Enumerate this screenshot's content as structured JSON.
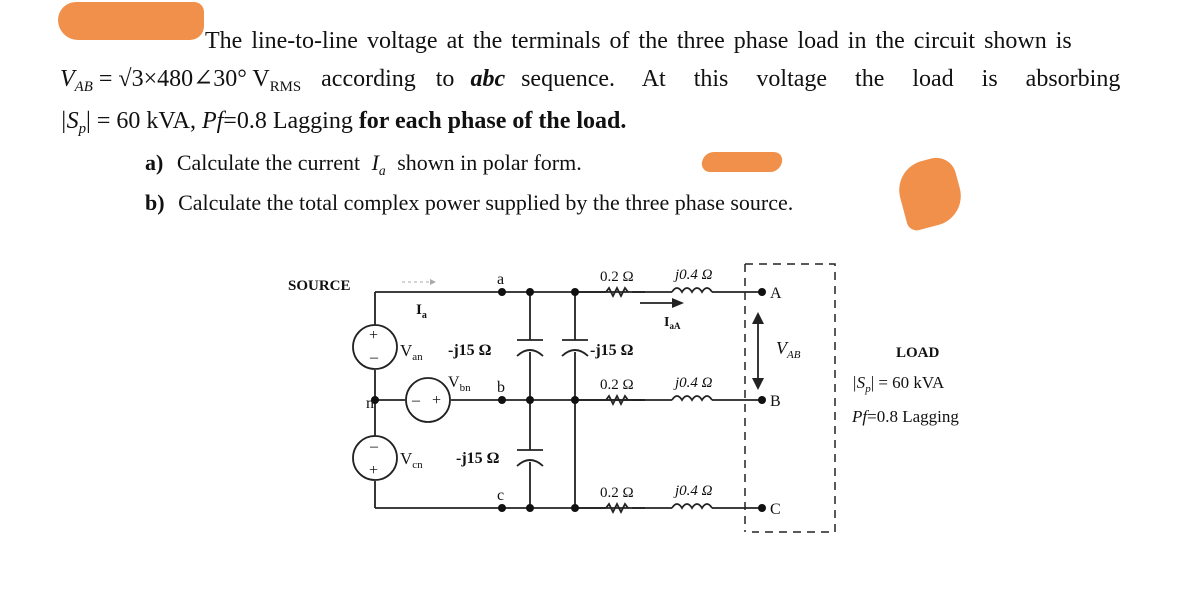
{
  "problem": {
    "line1": "The line-to-line voltage at the terminals of the three phase load in the circuit shown is",
    "line2_vab": "V",
    "line2_vab_sub": "AB",
    "line2_eq": "= √3×480∠30° V",
    "line2_rms_sub": "RMS",
    "line2_rest_a": "according to",
    "line2_abc": "abc",
    "line2_rest_b": "sequence. At this voltage the load is absorbing",
    "line3_sp": "|S",
    "line3_sp_sub": "p",
    "line3_sp_end": "| = 60 kVA,",
    "line3_pf": "Pf",
    "line3_pf_val": "=0.8 Lagging",
    "line3_bold": "for each phase of the load.",
    "part_a_label": "a)",
    "part_a_text": "Calculate the current",
    "part_a_var": "I",
    "part_a_var_sub": "a",
    "part_a_end": "shown in polar form.",
    "part_b_label": "b)",
    "part_b_text": "Calculate the total complex power supplied by the three phase source."
  },
  "redaction_color": "#f0904a",
  "circuit": {
    "source_title": "SOURCE",
    "load_title": "LOAD",
    "load_sp": "|S",
    "load_sp_sub": "p",
    "load_sp_val": "| = 60 kVA",
    "load_pf": "Pf",
    "load_pf_val": "=0.8 Lagging",
    "current_ia": "I",
    "current_ia_sub": "a",
    "current_iaa": "I",
    "current_iaa_sub": "aA",
    "van": "V",
    "van_sub": "an",
    "vbn": "V",
    "vbn_sub": "bn",
    "vcn": "V",
    "vcn_sub": "cn",
    "node_n": "n",
    "node_a": "a",
    "node_b": "b",
    "node_c": "c",
    "node_A": "A",
    "node_B": "B",
    "node_C": "C",
    "cap_label": "-j15 Ω",
    "line_resistor": "0.2 Ω",
    "line_inductor": "j0.4 Ω",
    "vab_label": "V",
    "vab_sub": "AB",
    "plus": "+",
    "minus": "–"
  }
}
